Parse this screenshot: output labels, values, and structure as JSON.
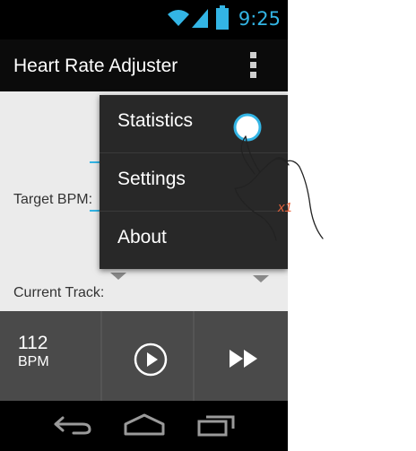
{
  "status_bar": {
    "time": "9:25",
    "icons": [
      "wifi-icon",
      "signal-icon",
      "battery-icon"
    ],
    "accent_color": "#33b5e5"
  },
  "action_bar": {
    "title": "Heart Rate Adjuster",
    "menu_icon": "overflow-menu-icon"
  },
  "form": {
    "target_bpm_label": "Target BPM:",
    "current_track_label": "Current Track:"
  },
  "controls": {
    "bpm_value": "112",
    "bpm_unit": "BPM",
    "play_icon": "play-icon",
    "next_icon": "fast-forward-icon"
  },
  "popup_menu": {
    "items": [
      {
        "label": "Statistics"
      },
      {
        "label": "Settings"
      },
      {
        "label": "About"
      }
    ]
  },
  "gesture": {
    "type": "tap",
    "count_label": "x1",
    "icon": "hand-tap-icon",
    "color": "#e8643c"
  },
  "nav_bar": {
    "icons": [
      "back-icon",
      "home-icon",
      "recents-icon"
    ]
  }
}
